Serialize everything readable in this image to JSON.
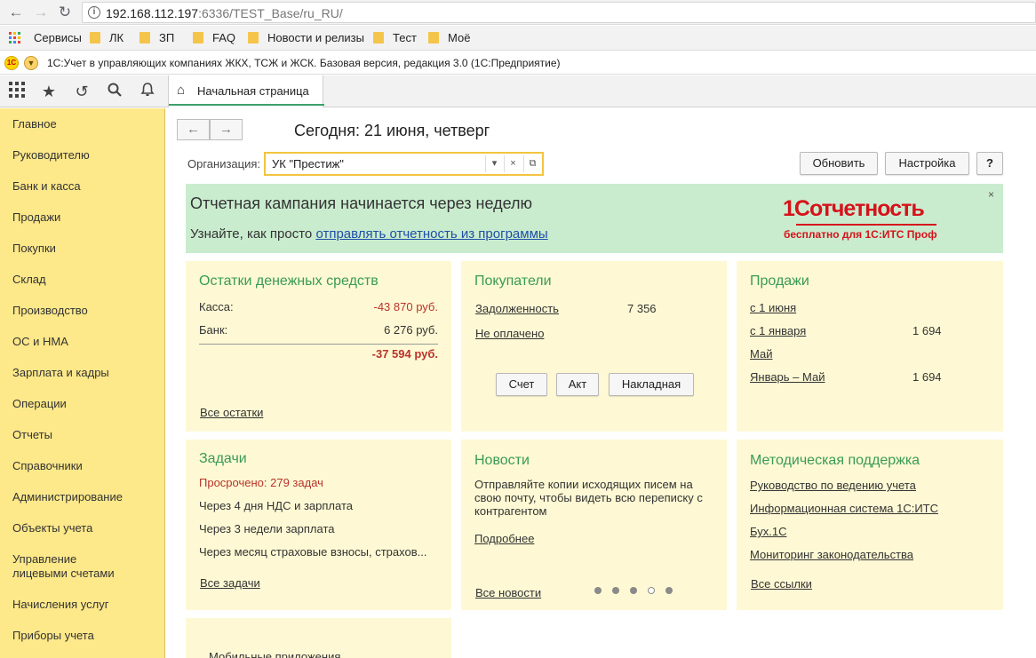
{
  "browser": {
    "url_host": "192.168.112.197",
    "url_rest": ":6336/TEST_Base/ru_RU/",
    "bookmarks": [
      "Сервисы",
      "ЛК",
      "ЗП",
      "FAQ",
      "Новости и релизы",
      "Тест",
      "Моё"
    ]
  },
  "app": {
    "title": "1С:Учет в управляющих компаниях ЖКХ, ТСЖ и ЖСК. Базовая версия, редакция 3.0   (1С:Предприятие)",
    "home_tab": "Начальная страница"
  },
  "sidebar": {
    "items": [
      "Главное",
      "Руководителю",
      "Банк и касса",
      "Продажи",
      "Покупки",
      "Склад",
      "Производство",
      "ОС и НМА",
      "Зарплата и кадры",
      "Операции",
      "Отчеты",
      "Справочники",
      "Администрирование",
      "Объекты учета",
      "Управление\nлицевыми счетами",
      "Начисления услуг",
      "Приборы учета"
    ]
  },
  "header": {
    "today": "Сегодня: 21 июня, четверг",
    "org_label": "Организация:",
    "org_value": "УК \"Престиж\"",
    "refresh": "Обновить",
    "settings": "Настройка",
    "help": "?"
  },
  "banner": {
    "title": "Отчетная кампания начинается через неделю",
    "sub_prefix": "Узнайте, как просто ",
    "sub_link": "отправлять отчетность из программы",
    "logo_text": "1Сотчетность",
    "logo_tagline": "бесплатно для 1С:ИТС Проф",
    "close": "×"
  },
  "cash": {
    "title": "Остатки денежных средств",
    "kassa_label": "Касса:",
    "kassa_value": "-43 870 руб.",
    "bank_label": "Банк:",
    "bank_value": "6 276 руб.",
    "total": "-37 594 руб.",
    "link": "Все остатки"
  },
  "buyers": {
    "title": "Покупатели",
    "debt_label": "Задолженность",
    "debt_value": "7 356",
    "unpaid": "Не оплачено",
    "btn_invoice": "Счет",
    "btn_act": "Акт",
    "btn_waybill": "Накладная"
  },
  "sales": {
    "title": "Продажи",
    "rows": [
      {
        "label": "с 1 июня",
        "value": ""
      },
      {
        "label": "с 1 января",
        "value": "1 694"
      },
      {
        "label": "Май",
        "value": ""
      },
      {
        "label": "Январь – Май",
        "value": "1 694"
      }
    ]
  },
  "tasks": {
    "title": "Задачи",
    "overdue": "Просрочено: 279 задач",
    "items": [
      "Через 4 дня НДС и зарплата",
      "Через 3 недели зарплата",
      "Через месяц страховые взносы, страхов..."
    ],
    "link": "Все задачи"
  },
  "news": {
    "title": "Новости",
    "text": "Отправляйте копии исходящих писем на свою почту, чтобы видеть всю переписку с контрагентом",
    "more": "Подробнее",
    "all": "Все новости",
    "active_dot": 4
  },
  "support": {
    "title": "Методическая поддержка",
    "links": [
      "Руководство по ведению учета",
      "Информационная система 1С:ИТС",
      "Бух.1С",
      "Мониторинг законодательства"
    ],
    "all": "Все ссылки"
  },
  "mobile": {
    "title": "Мобильные приложения"
  }
}
